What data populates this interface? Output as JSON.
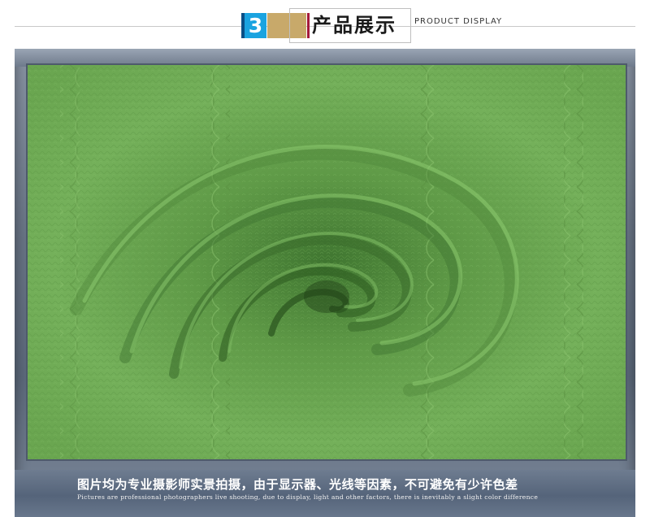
{
  "header": {
    "number": "3",
    "title_cn": "产品展示",
    "title_en": "PRODUCT DISPLAY",
    "colors": {
      "badge": "#1aa3e0",
      "badge_edge": "#0a4f86",
      "gold": "#c8a96a",
      "red": "#a4193b"
    }
  },
  "photo": {
    "subject": "green-knit-fabric-swirl",
    "base_color": "#6fa855"
  },
  "caption": {
    "text_cn": "图片均为专业摄影师实景拍摄，由于显示器、光线等因素，不可避免有少许色差",
    "text_en": "Pictures are professional photographers live shooting, due to display, light and other factors, there is inevitably a slight color difference"
  }
}
